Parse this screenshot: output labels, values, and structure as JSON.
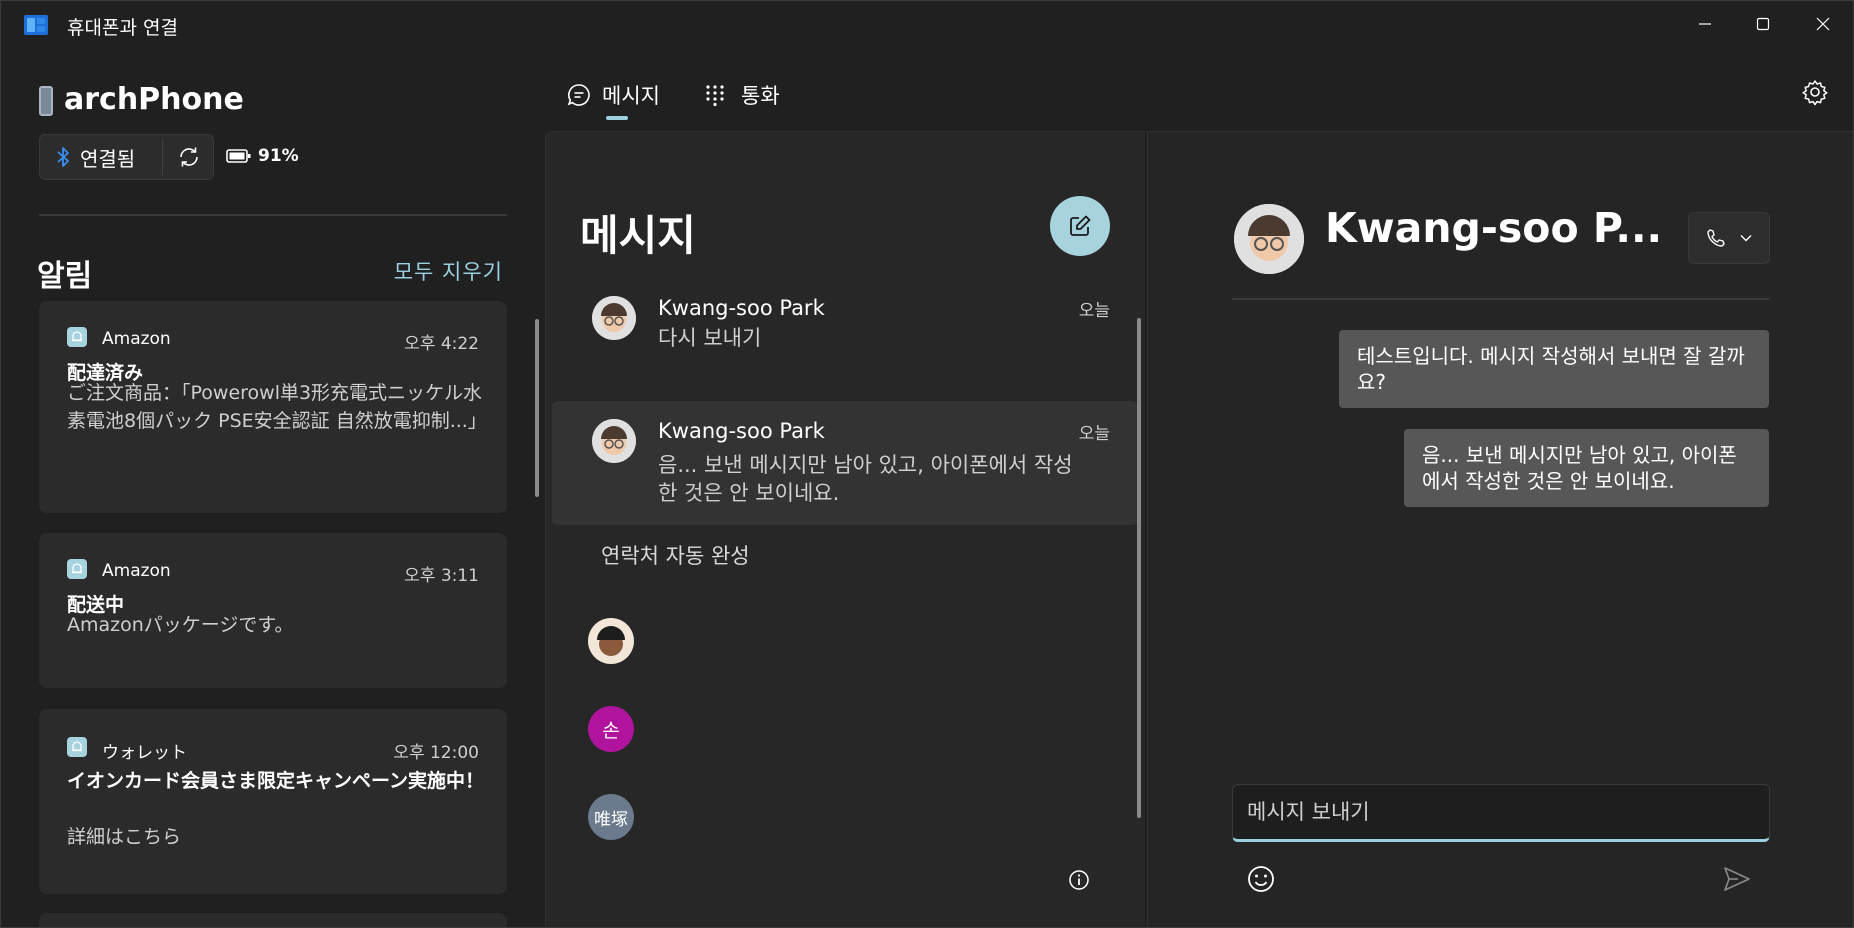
{
  "window": {
    "title": "휴대폰과 연결"
  },
  "device": {
    "name": "archPhone",
    "status_label": "연결됨",
    "battery": "91%"
  },
  "notifications": {
    "title": "알림",
    "clear_all": "모두 지우기",
    "items": [
      {
        "app": "Amazon",
        "time": "오후 4:22",
        "heading": "配達済み",
        "body": "ご注文商品：｢Powerowl単3形充電式ニッケル水素電池8個パック PSE安全認証 自然放電抑制...｣"
      },
      {
        "app": "Amazon",
        "time": "오후 3:11",
        "heading": "配送中",
        "body": "Amazonパッケージです。"
      },
      {
        "app": "ウォレット",
        "time": "오후 12:00",
        "heading": "イオンカード会員さま限定キャンペーン実施中！",
        "body": "詳細はこちら"
      }
    ]
  },
  "tabs": [
    {
      "label": "메시지"
    },
    {
      "label": "통화"
    }
  ],
  "messages": {
    "title": "메시지",
    "conversations": [
      {
        "name": "Kwang-soo Park",
        "time": "오늘",
        "text": "다시 보내기"
      },
      {
        "name": "Kwang-soo Park",
        "time": "오늘",
        "text": "음... 보낸 메시지만 남아 있고, 아이폰에서 작성한 것은 안 보이네요."
      }
    ],
    "autocomplete_label": "연락처 자동 완성",
    "contacts": [
      {
        "initial": ""
      },
      {
        "initial": "손",
        "color": "#b0149c"
      },
      {
        "initial": "唯塚",
        "color": "#6b7a8c"
      }
    ]
  },
  "chat": {
    "contact_name": "Kwang-soo P...",
    "bubbles": [
      {
        "text": "테스트입니다. 메시지 작성해서 보내면 잘 갈까요?"
      },
      {
        "text": "음... 보낸 메시지만 남아 있고, 아이폰에서 작성한 것은 안 보이네요."
      }
    ],
    "input_placeholder": "메시지 보내기"
  },
  "colors": {
    "accent": "#9ad0e0",
    "background": "#202020",
    "bubble": "#575757"
  }
}
